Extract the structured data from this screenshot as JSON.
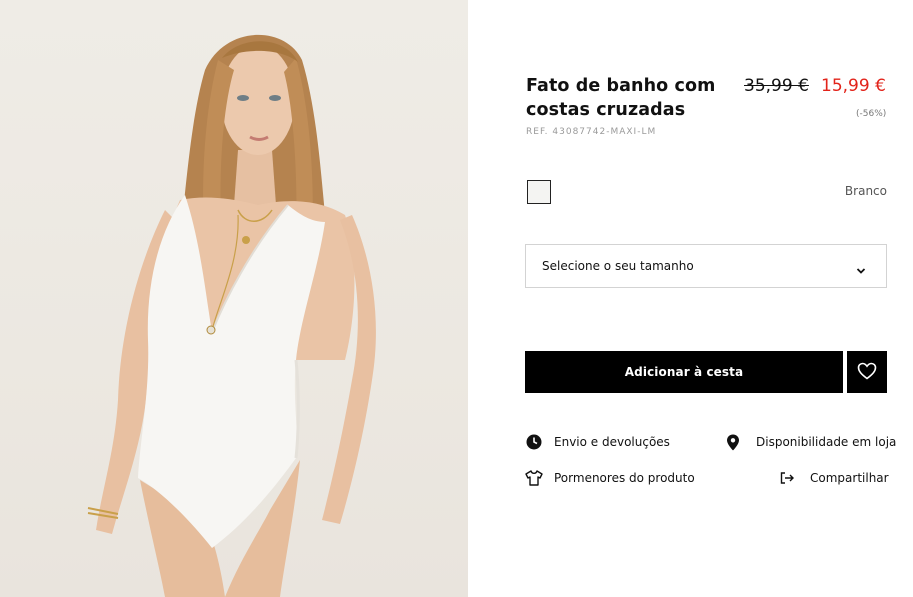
{
  "product": {
    "title": "Fato de banho com costas cruzadas",
    "old_price": "35,99 €",
    "new_price": "15,99 €",
    "discount": "(-56%)",
    "ref": "REF. 43087742-MAXI-LM",
    "image_alt_icon": "product-photo"
  },
  "color": {
    "swatch_hex": "#f4f4f2",
    "name": "Branco"
  },
  "size": {
    "placeholder": "Selecione o seu tamanho",
    "icon": "chevron-down-icon"
  },
  "actions": {
    "add_to_cart": "Adicionar à cesta",
    "wishlist_icon": "heart-icon"
  },
  "links": {
    "shipping": "Envio e devoluções",
    "availability": "Disponibilidade em loja",
    "details": "Pormenores do produto",
    "share": "Compartilhar"
  },
  "colors": {
    "sale_red": "#e2231a",
    "button_black": "#000000"
  }
}
